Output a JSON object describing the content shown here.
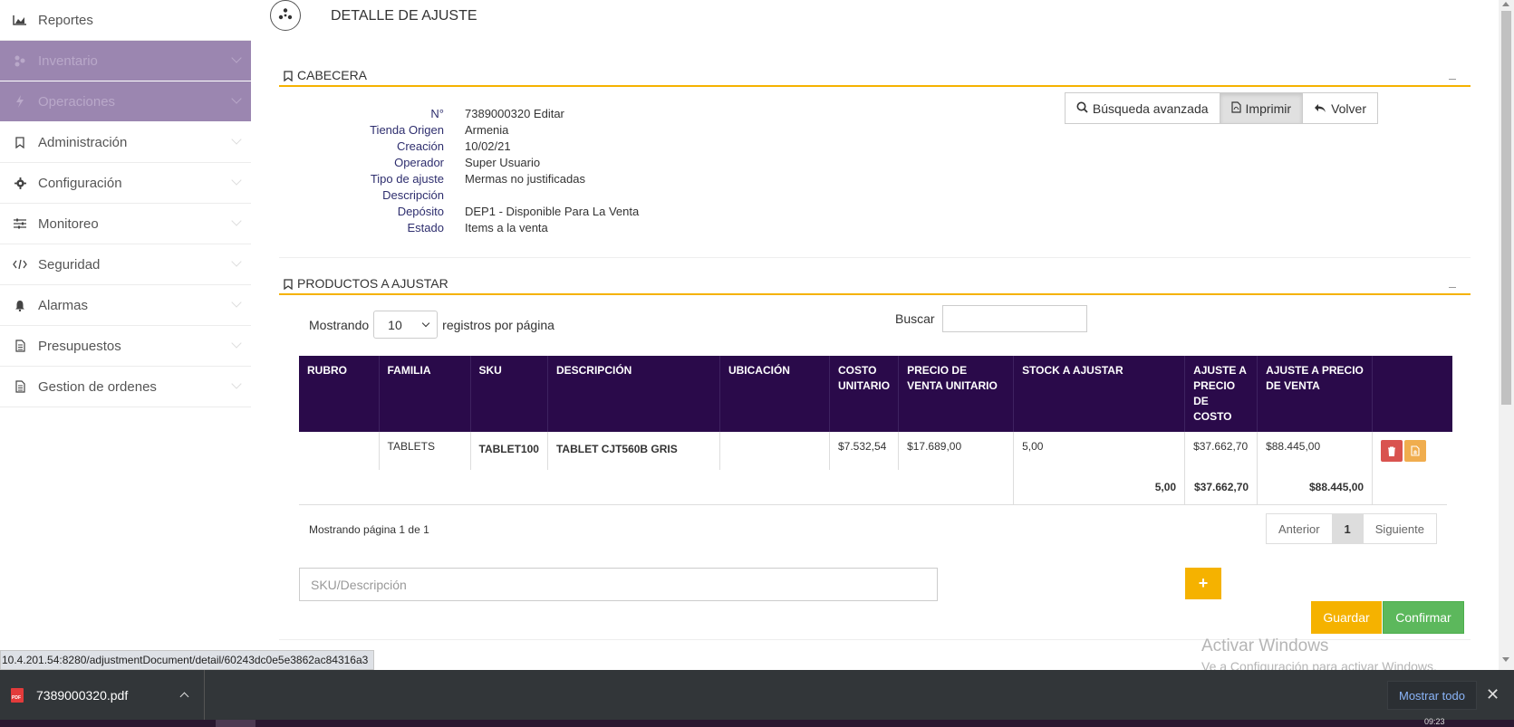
{
  "sidebar": {
    "items": [
      {
        "label": "Reportes",
        "icon": "chart-area-icon"
      },
      {
        "label": "Inventario",
        "icon": "cubes-icon"
      },
      {
        "label": "Operaciones",
        "icon": "bolt-icon"
      },
      {
        "label": "Administración",
        "icon": "bookmark-icon"
      },
      {
        "label": "Configuración",
        "icon": "gear-icon"
      },
      {
        "label": "Monitoreo",
        "icon": "sliders-icon"
      },
      {
        "label": "Seguridad",
        "icon": "code-icon"
      },
      {
        "label": "Alarmas",
        "icon": "bell-icon"
      },
      {
        "label": "Presupuestos",
        "icon": "file-text-icon"
      },
      {
        "label": "Gestion de ordenes",
        "icon": "file-text-icon"
      }
    ]
  },
  "header": {
    "title": "DETALLE DE AJUSTE"
  },
  "cabecera": {
    "title": "CABECERA",
    "buttons": {
      "advanced_search": "Búsqueda avanzada",
      "print": "Imprimir",
      "back": "Volver"
    },
    "fields": [
      {
        "label": "N°",
        "value": "7389000320 Editar"
      },
      {
        "label": "Tienda Origen",
        "value": "Armenia"
      },
      {
        "label": "Creación",
        "value": "10/02/21"
      },
      {
        "label": "Operador",
        "value": "Super Usuario"
      },
      {
        "label": "Tipo de ajuste",
        "value": "Mermas no justificadas"
      },
      {
        "label": "Descripción",
        "value": ""
      },
      {
        "label": "Depósito",
        "value": "DEP1 - Disponible Para La Venta"
      },
      {
        "label": "Estado",
        "value": "Items a la venta"
      }
    ]
  },
  "productos": {
    "title": "PRODUCTOS A AJUSTAR",
    "length_prefix": "Mostrando",
    "length_value": "10",
    "length_suffix": "registros por página",
    "search_label": "Buscar",
    "search_value": "",
    "columns": [
      "RUBRO",
      "FAMILIA",
      "SKU",
      "DESCRIPCIÓN",
      "UBICACIÓN",
      "COSTO UNITARIO",
      "PRECIO DE VENTA UNITARIO",
      "STOCK A AJUSTAR",
      "AJUSTE A PRECIO DE COSTO",
      "AJUSTE A PRECIO DE VENTA",
      ""
    ],
    "rows": [
      {
        "rubro": "",
        "familia": "TABLETS",
        "sku": "TABLET100",
        "descripcion": "TABLET CJT560B GRIS",
        "ubicacion": "",
        "costo": "$7.532,54",
        "precio": "$17.689,00",
        "stock": "5,00",
        "ajuste_costo": "$37.662,70",
        "ajuste_venta": "$88.445,00"
      }
    ],
    "totals": {
      "stock": "5,00",
      "ajuste_costo": "$37.662,70",
      "ajuste_venta": "$88.445,00"
    },
    "page_info": "Mostrando página 1 de 1",
    "pager": {
      "prev": "Anterior",
      "current": "1",
      "next": "Siguiente"
    },
    "sku_placeholder": "SKU/Descripción",
    "add_label": "+",
    "save_label": "Guardar",
    "confirm_label": "Confirmar"
  },
  "watermark": {
    "line1": "Activar Windows",
    "line2": "Ve a Configuración para activar Windows."
  },
  "status_url": "10.4.201.54:8280/adjustmentDocument/detail/60243dc0e5e3862ac84316a3",
  "downloads": {
    "file": "7389000320.pdf",
    "show_all": "Mostrar todo"
  },
  "taskbar": {
    "clock": "09:23"
  },
  "colors": {
    "accent": "#f5b200",
    "header_bg": "#2a0a4a",
    "sidebar_active": "#9b86b0",
    "confirm": "#5cb85c",
    "delete": "#d9534f",
    "edit": "#f0ad4e"
  }
}
